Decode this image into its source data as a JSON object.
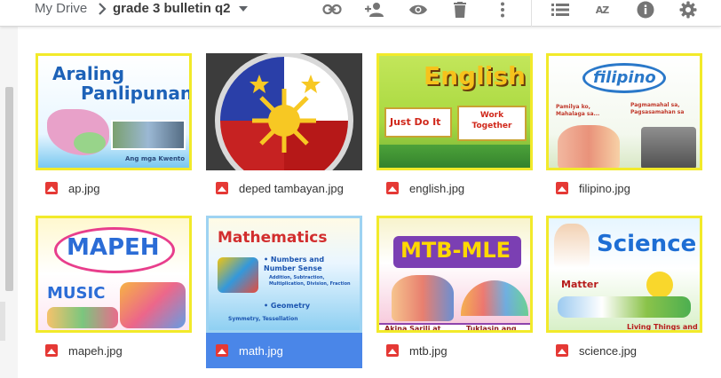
{
  "breadcrumb": {
    "root": "My Drive",
    "current": "grade 3 bulletin q2"
  },
  "toolbar": {
    "icons": [
      "link-icon",
      "add-person-icon",
      "eye-icon",
      "trash-icon",
      "more-vert-icon",
      "list-view-icon",
      "sort-az-icon",
      "info-icon",
      "settings-icon"
    ],
    "sort_label": "AZ"
  },
  "files": [
    {
      "name": "ap.jpg",
      "thumb_title": "Araling",
      "thumb_title2": "Panlipunan",
      "thumb_sub": "Ang mga Kwento"
    },
    {
      "name": "deped tambayan.jpg"
    },
    {
      "name": "english.jpg",
      "thumb_title": "English",
      "thumb_sub": "Just Do It",
      "thumb_sub2": "Work Together"
    },
    {
      "name": "filipino.jpg",
      "thumb_title": "filipino",
      "thumb_sub": "Pamilya ko, Mahalaga sa...",
      "thumb_sub2": "Pagmamahal sa, Pagsasamahan sa"
    },
    {
      "name": "mapeh.jpg",
      "thumb_title": "MAPEH",
      "thumb_sub": "MUSIC"
    },
    {
      "name": "math.jpg",
      "selected": true,
      "thumb_title": "Mathematics",
      "thumb_sub": "• Numbers and Number Sense",
      "thumb_sub2": "Addition, Subtraction, Multiplication, Division, Fraction",
      "thumb_sub3": "• Geometry",
      "thumb_sub4": "Symmetry, Tessellation"
    },
    {
      "name": "mtb.jpg",
      "thumb_title": "MTB-MLE",
      "thumb_sub": "Akina Sarili at",
      "thumb_sub2": "Tuklasin ang"
    },
    {
      "name": "science.jpg",
      "thumb_title": "Science",
      "thumb_sub": "Matter",
      "thumb_sub2": "Living Things and"
    }
  ],
  "colors": {
    "accent": "#4a86e8",
    "thumb_border": "#f2ea2a",
    "file_icon": "#e53935"
  }
}
